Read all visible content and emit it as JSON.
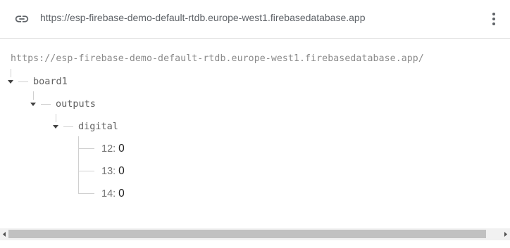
{
  "header": {
    "url": "https://esp-firebase-demo-default-rtdb.europe-west1.firebasedatabase.app",
    "link_icon": "link-icon",
    "menu_icon": "more-vert-icon"
  },
  "tree": {
    "root_url": "https://esp-firebase-demo-default-rtdb.europe-west1.firebasedatabase.app/",
    "board": {
      "key": "board1"
    },
    "outputs": {
      "key": "outputs"
    },
    "digital": {
      "key": "digital"
    },
    "leaves": [
      {
        "key": "12",
        "value": "0"
      },
      {
        "key": "13",
        "value": "0"
      },
      {
        "key": "14",
        "value": "0"
      }
    ]
  },
  "colors": {
    "tree_line": "#d0d0d0",
    "scroll_thumb": "#c1c1c1",
    "scroll_track": "#f1f1f1"
  }
}
